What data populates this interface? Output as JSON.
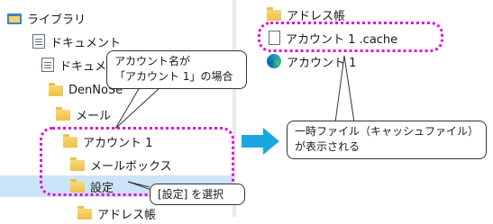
{
  "tree": {
    "library": "ライブラリ",
    "documents": "ドキュメント",
    "documents_sub": "ドキュメント",
    "dennos": "DenNoSe",
    "mail": "メール",
    "account": "アカウント 1",
    "mailbox": "メールボックス",
    "settings": "設定",
    "address": "アドレス帳"
  },
  "files": {
    "address_book": "アドレス帳",
    "account_cache": "アカウント 1 .cache",
    "account_edge": "アカウント 1"
  },
  "callouts": {
    "account_name_line1": "アカウント名が",
    "account_name_line2": "「アカウント 1」の場合",
    "select_settings": "[設定] を選択",
    "temp_file_line1": "一時ファイル（キャッシュファイル）",
    "temp_file_line2": "が表示される"
  },
  "colors": {
    "highlight": "#e10fd8",
    "arrow": "#1aa6e0",
    "selection": "#cce4f7"
  }
}
